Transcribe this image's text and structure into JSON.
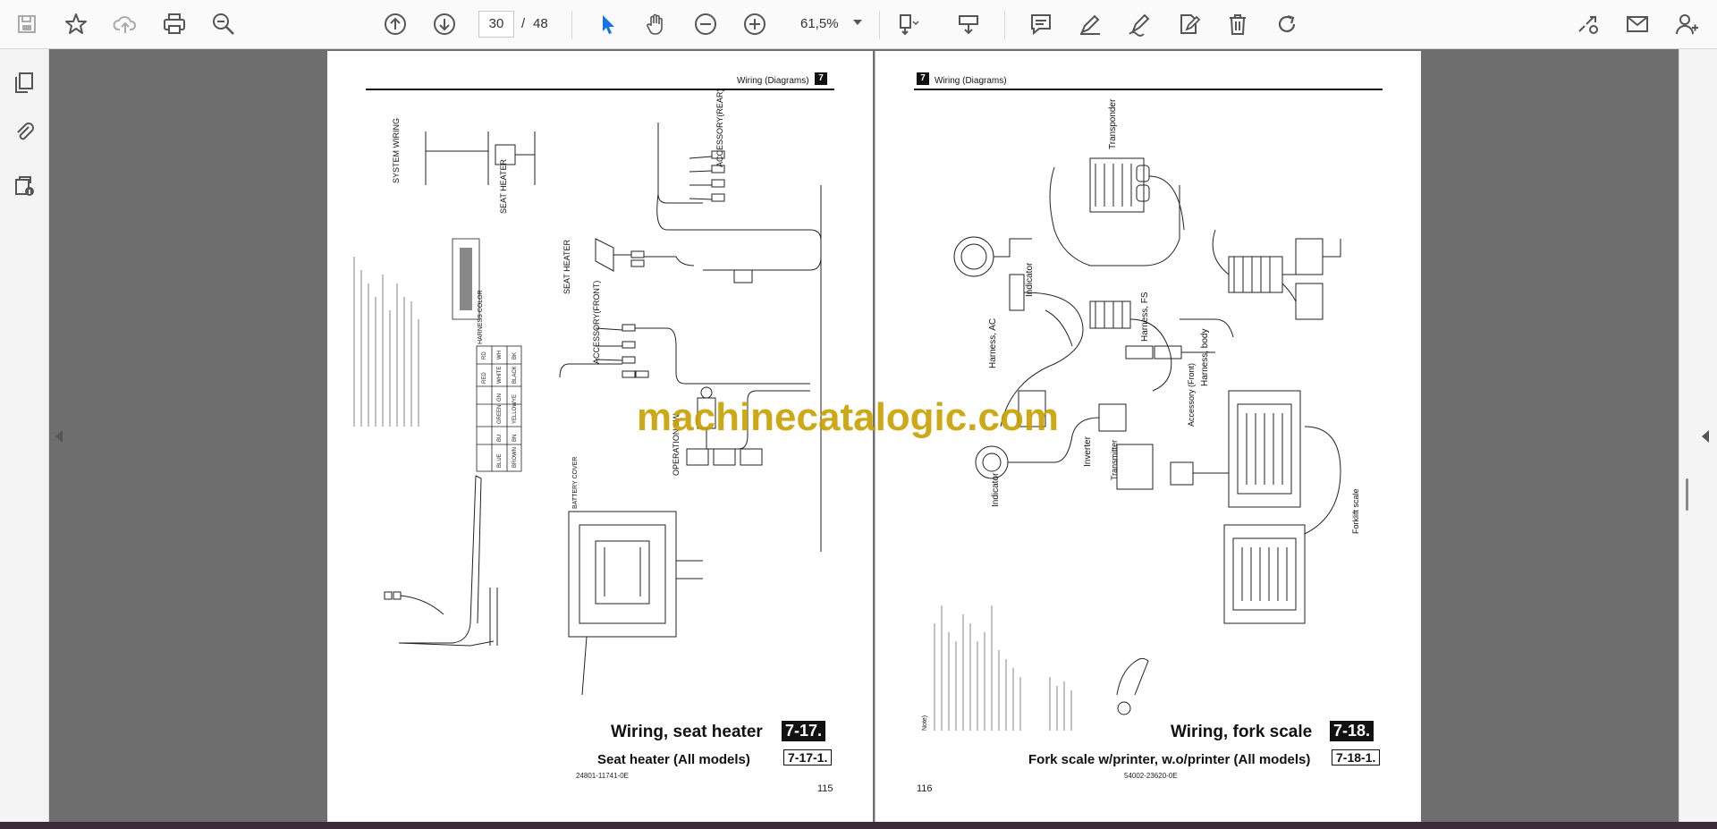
{
  "toolbar": {
    "current_page": "30",
    "page_separator": "/",
    "total_pages": "48",
    "zoom": "61,5%"
  },
  "left_page": {
    "header_title": "Wiring (Diagrams)",
    "header_section": "7",
    "title": "Wiring, seat heater",
    "title_num": "7-17.",
    "subtitle": "Seat heater (All models)",
    "subtitle_num": "7-17-1.",
    "doc_code": "24801-11741-0E",
    "page_number": "115",
    "labels": {
      "system_wiring": "SYSTEM WIRING",
      "seat_heater": "SEAT HEATER",
      "accessory_rear": "ACCESSORY(REAR)",
      "accessory_front": "ACCESSORY(FRONT)",
      "operation_sw": "OPERATION SW",
      "harness_color": "HARNESS COLOR",
      "battery_cover": "BATTERY COVER"
    },
    "color_table": [
      [
        "BK",
        "BLACK",
        "YE",
        "YELLOW",
        "BN",
        "BROWN"
      ],
      [
        "WH",
        "WHITE",
        "GN",
        "GREEN",
        "BU",
        "BLUE"
      ],
      [
        "RD",
        "RED",
        "",
        "",
        "",
        ""
      ]
    ]
  },
  "right_page": {
    "header_title": "Wiring (Diagrams)",
    "header_section": "7",
    "title": "Wiring, fork scale",
    "title_num": "7-18.",
    "subtitle": "Fork scale w/printer, w.o/printer (All models)",
    "subtitle_num": "7-18-1.",
    "doc_code": "54002-23620-0E",
    "page_number": "116",
    "labels": {
      "transponder": "Transponder",
      "indicator": "Indicator",
      "harness_ac": "Harness, AC",
      "harness_fs": "Harness, FS",
      "harness_body": "Harness, body",
      "accessory_front": "Accessory (Front)",
      "inverter": "Inverter",
      "transmitter": "Transmitter",
      "forklift_scale": "Forklift scale",
      "note": "Note)"
    }
  },
  "watermark": "machinecatalogic.com",
  "colors": {
    "toolbar_bg": "#fafafa",
    "viewer_bg": "#6e6e6e",
    "accent_blue": "#1473e6",
    "watermark": "#c8a000"
  }
}
